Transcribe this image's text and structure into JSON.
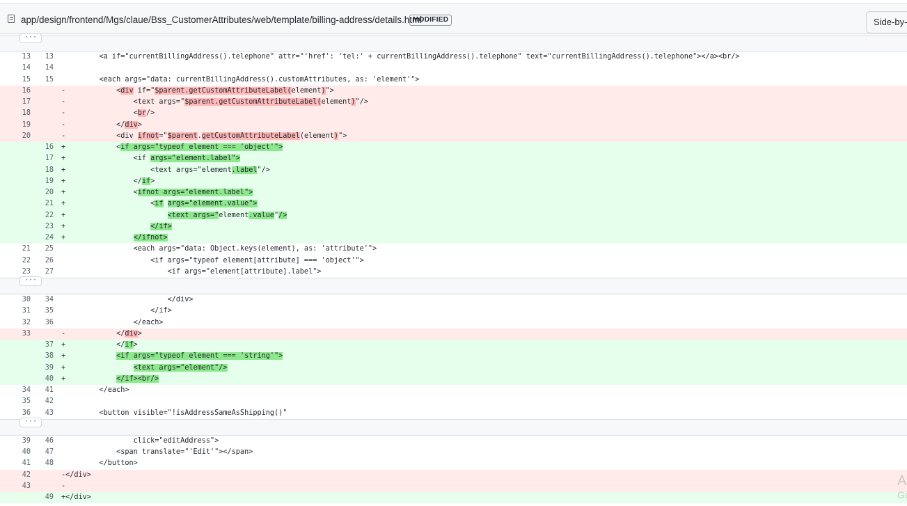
{
  "file": {
    "path": "app/design/frontend/Mgs/claue/Bss_CustomerAttributes/web/template/billing-address/details.html",
    "status_badge": "MODIFIED",
    "view_toggle": "Side-by-side"
  },
  "expand_label": "···",
  "watermark": {
    "line1": "Ac",
    "line2": "Go"
  },
  "colors": {
    "deleted_bg": "#ffebe9",
    "added_bg": "#e6ffec",
    "deleted_word": "#ffb8b8",
    "added_word": "#8ee88e"
  },
  "lines": [
    {
      "kind": "hunk"
    },
    {
      "kind": "ctx",
      "old": "13",
      "new": "13",
      "segs": [
        [
          "    <a if=\"currentBillingAddress().telephone\" attr=\"'href': 'tel:' + currentBillingAddress().telephone\" text=\"currentBillingAddress().telephone\"></a><br/>",
          0
        ]
      ]
    },
    {
      "kind": "ctx",
      "old": "14",
      "new": "14",
      "segs": [
        [
          "",
          0
        ]
      ]
    },
    {
      "kind": "ctx",
      "old": "15",
      "new": "15",
      "segs": [
        [
          "    <each args=\"data: currentBillingAddress().customAttributes, as: 'element'\">",
          0
        ]
      ]
    },
    {
      "kind": "del",
      "old": "16",
      "new": "",
      "segs": [
        [
          "        <",
          0
        ],
        [
          "div",
          1
        ],
        [
          " if=\"",
          0
        ],
        [
          "$parent.getCustomAttributeLabel(",
          1
        ],
        [
          "element",
          0
        ],
        [
          ")",
          1
        ],
        [
          "\">",
          0
        ]
      ]
    },
    {
      "kind": "del",
      "old": "17",
      "new": "",
      "segs": [
        [
          "            <text args=\"",
          0
        ],
        [
          "$parent.getCustomAttributeLabel(",
          1
        ],
        [
          "element",
          0
        ],
        [
          ")",
          1
        ],
        [
          "\"/>",
          0
        ]
      ]
    },
    {
      "kind": "del",
      "old": "18",
      "new": "",
      "segs": [
        [
          "            <",
          0
        ],
        [
          "br",
          1
        ],
        [
          "/>",
          0
        ]
      ]
    },
    {
      "kind": "del",
      "old": "19",
      "new": "",
      "segs": [
        [
          "        </",
          0
        ],
        [
          "div",
          1
        ],
        [
          ">",
          0
        ]
      ]
    },
    {
      "kind": "del",
      "old": "20",
      "new": "",
      "segs": [
        [
          "        <div ",
          0
        ],
        [
          "ifnot",
          1
        ],
        [
          "=\"",
          0
        ],
        [
          "$parent",
          1
        ],
        [
          ".",
          0
        ],
        [
          "getCustomAttributeLabel",
          1
        ],
        [
          "(element",
          0
        ],
        [
          ")",
          1
        ],
        [
          "\">",
          0
        ]
      ]
    },
    {
      "kind": "add",
      "old": "",
      "new": "16",
      "segs": [
        [
          "        <",
          0
        ],
        [
          "if args=\"typeof element === 'object'\">",
          1
        ]
      ]
    },
    {
      "kind": "add",
      "old": "",
      "new": "17",
      "segs": [
        [
          "            <if ",
          0
        ],
        [
          "args=\"element.label\">",
          1
        ]
      ]
    },
    {
      "kind": "add",
      "old": "",
      "new": "18",
      "segs": [
        [
          "                <text args=\"element",
          0
        ],
        [
          ".label",
          1
        ],
        [
          "\"/>",
          0
        ]
      ]
    },
    {
      "kind": "add",
      "old": "",
      "new": "19",
      "segs": [
        [
          "            </",
          0
        ],
        [
          "if",
          1
        ],
        [
          ">",
          0
        ]
      ]
    },
    {
      "kind": "add",
      "old": "",
      "new": "20",
      "segs": [
        [
          "            <",
          0
        ],
        [
          "ifnot args=\"element.label\">",
          1
        ]
      ]
    },
    {
      "kind": "add",
      "old": "",
      "new": "21",
      "segs": [
        [
          "                <",
          0
        ],
        [
          "if",
          1
        ],
        [
          " ",
          0
        ],
        [
          "args=\"element.value\">",
          1
        ]
      ]
    },
    {
      "kind": "add",
      "old": "",
      "new": "22",
      "segs": [
        [
          "                    ",
          0
        ],
        [
          "<text args=\"",
          1
        ],
        [
          "element",
          0
        ],
        [
          ".value",
          1
        ],
        [
          "\"",
          0
        ],
        [
          "/>",
          1
        ]
      ]
    },
    {
      "kind": "add",
      "old": "",
      "new": "23",
      "segs": [
        [
          "                ",
          0
        ],
        [
          "</if>",
          1
        ]
      ]
    },
    {
      "kind": "add",
      "old": "",
      "new": "24",
      "segs": [
        [
          "            ",
          0
        ],
        [
          "</ifnot>",
          1
        ]
      ]
    },
    {
      "kind": "ctx",
      "old": "21",
      "new": "25",
      "segs": [
        [
          "            <each args=\"data: Object.keys(element), as: 'attribute'\">",
          0
        ]
      ]
    },
    {
      "kind": "ctx",
      "old": "22",
      "new": "26",
      "segs": [
        [
          "                <if args=\"typeof element[attribute] === 'object'\">",
          0
        ]
      ]
    },
    {
      "kind": "ctx",
      "old": "23",
      "new": "27",
      "segs": [
        [
          "                    <if args=\"element[attribute].label\">",
          0
        ]
      ]
    },
    {
      "kind": "hunk"
    },
    {
      "kind": "ctx",
      "old": "30",
      "new": "34",
      "segs": [
        [
          "                    </div>",
          0
        ]
      ]
    },
    {
      "kind": "ctx",
      "old": "31",
      "new": "35",
      "segs": [
        [
          "                </if>",
          0
        ]
      ]
    },
    {
      "kind": "ctx",
      "old": "32",
      "new": "36",
      "segs": [
        [
          "            </each>",
          0
        ]
      ]
    },
    {
      "kind": "del",
      "old": "33",
      "new": "",
      "segs": [
        [
          "        </",
          0
        ],
        [
          "div",
          1
        ],
        [
          ">",
          0
        ]
      ]
    },
    {
      "kind": "add",
      "old": "",
      "new": "37",
      "segs": [
        [
          "        </",
          0
        ],
        [
          "if",
          1
        ],
        [
          ">",
          0
        ]
      ]
    },
    {
      "kind": "add",
      "old": "",
      "new": "38",
      "segs": [
        [
          "        ",
          0
        ],
        [
          "<if args=\"typeof element === 'string'\">",
          1
        ]
      ]
    },
    {
      "kind": "add",
      "old": "",
      "new": "39",
      "segs": [
        [
          "            ",
          0
        ],
        [
          "<text args=\"element\"/>",
          1
        ]
      ]
    },
    {
      "kind": "add",
      "old": "",
      "new": "40",
      "segs": [
        [
          "        ",
          0
        ],
        [
          "</if><br/>",
          1
        ]
      ]
    },
    {
      "kind": "ctx",
      "old": "34",
      "new": "41",
      "segs": [
        [
          "    </each>",
          0
        ]
      ]
    },
    {
      "kind": "ctx",
      "old": "35",
      "new": "42",
      "segs": [
        [
          "",
          0
        ]
      ]
    },
    {
      "kind": "ctx",
      "old": "36",
      "new": "43",
      "segs": [
        [
          "    <button visible=\"!isAddressSameAsShipping()\"",
          0
        ]
      ]
    },
    {
      "kind": "hunk"
    },
    {
      "kind": "ctx",
      "old": "39",
      "new": "46",
      "segs": [
        [
          "            click=\"editAddress\">",
          0
        ]
      ]
    },
    {
      "kind": "ctx",
      "old": "40",
      "new": "47",
      "segs": [
        [
          "        <span translate=\"'Edit'\"></span>",
          0
        ]
      ]
    },
    {
      "kind": "ctx",
      "old": "41",
      "new": "48",
      "segs": [
        [
          "    </button>",
          0
        ]
      ]
    },
    {
      "kind": "del",
      "old": "42",
      "new": "",
      "segs": [
        [
          "</div>",
          0
        ]
      ]
    },
    {
      "kind": "del",
      "old": "43",
      "new": "",
      "segs": [
        [
          "",
          0
        ]
      ]
    },
    {
      "kind": "add",
      "old": "",
      "new": "49",
      "segs": [
        [
          "</div>",
          0
        ]
      ]
    }
  ]
}
